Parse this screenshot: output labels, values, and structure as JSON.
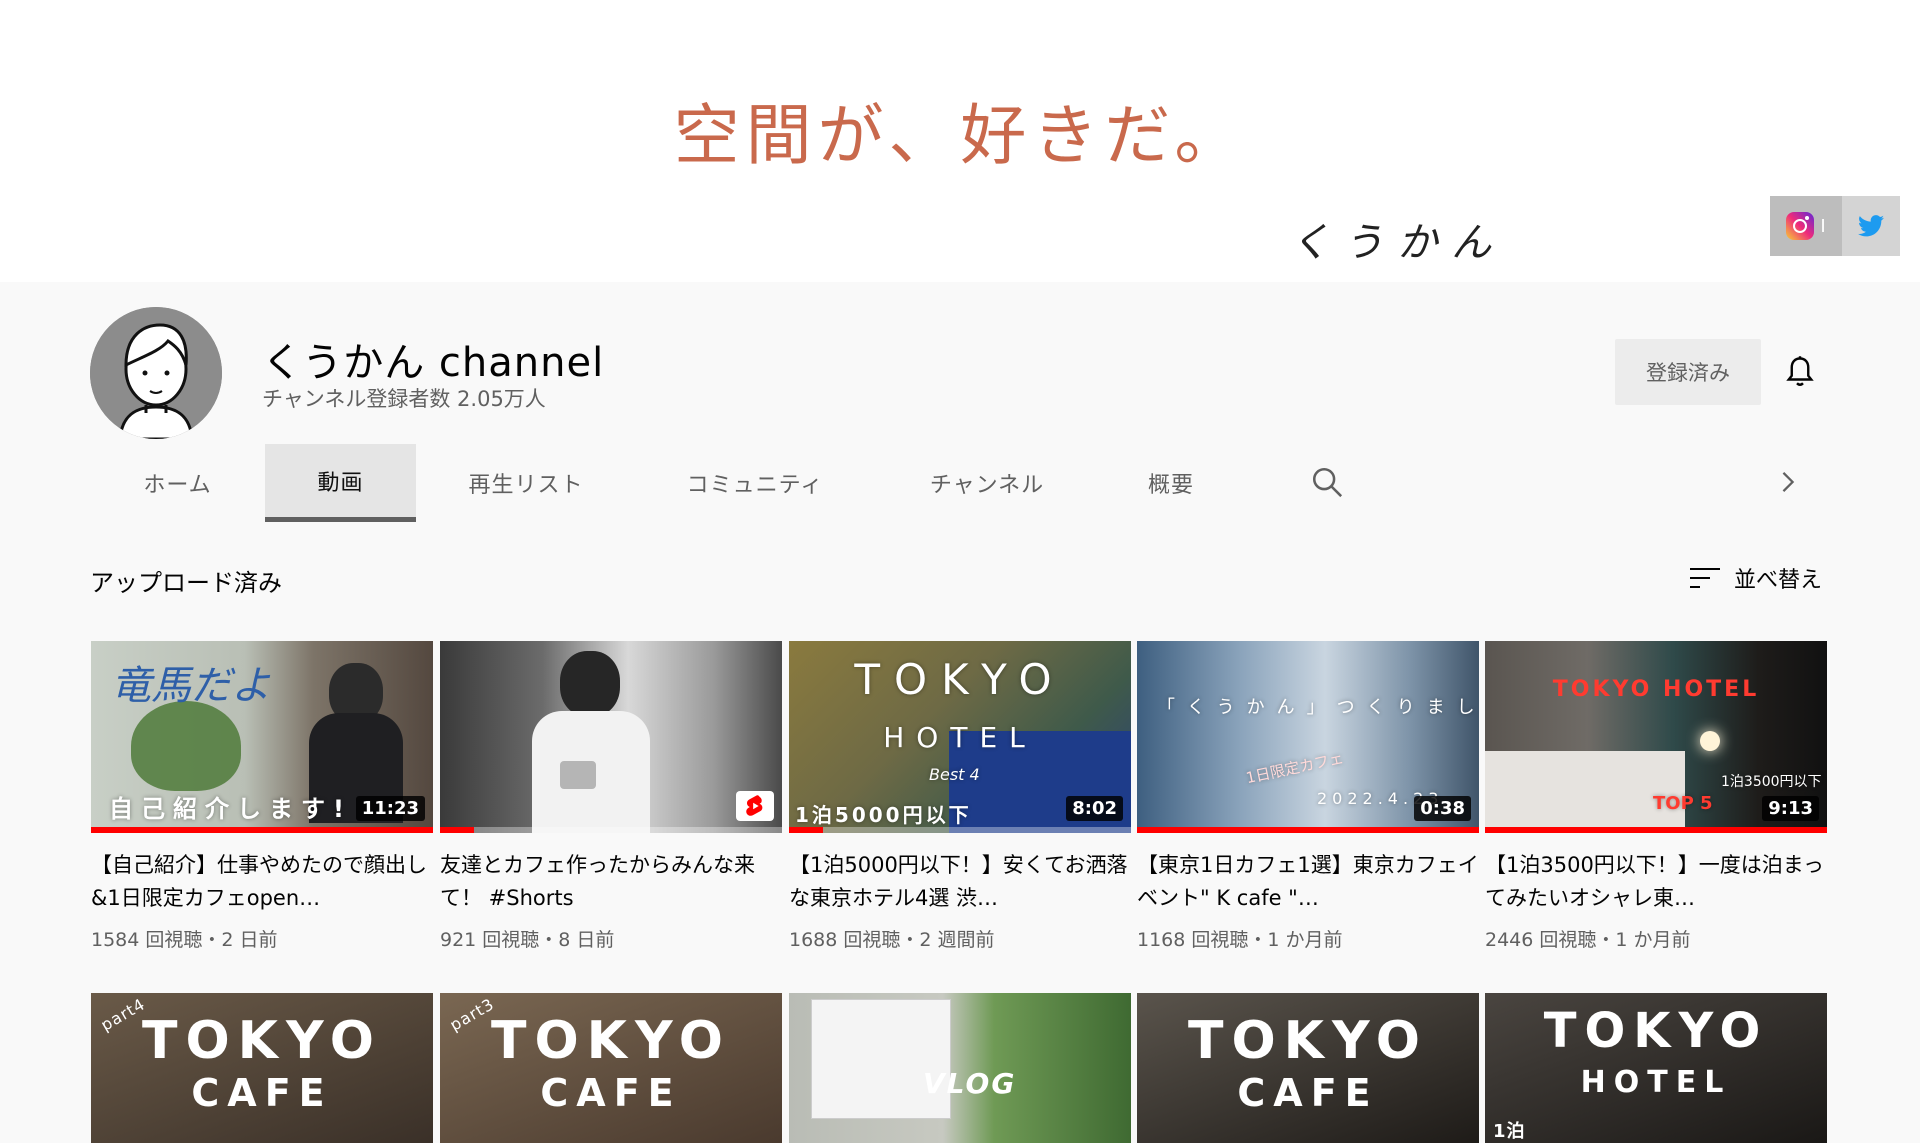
{
  "banner": {
    "tagline": "空間が、好きだ。",
    "signature": "くうかん",
    "links": {
      "instagram_icon": "instagram-icon",
      "twitter_icon": "twitter-icon",
      "instagram_text": "I"
    }
  },
  "channel": {
    "name": "くうかん channel",
    "subscribers": "チャンネル登録者数 2.05万人",
    "subscribe_label": "登録済み"
  },
  "tabs": [
    {
      "label": "ホーム"
    },
    {
      "label": "動画",
      "active": true
    },
    {
      "label": "再生リスト"
    },
    {
      "label": "コミュニティ"
    },
    {
      "label": "チャンネル"
    },
    {
      "label": "概要"
    }
  ],
  "section": {
    "title": "アップロード済み",
    "sort_label": "並べ替え"
  },
  "videos": [
    {
      "title": "【自己紹介】仕事やめたので顔出し&1日限定カフェopen…",
      "meta": "1584 回視聴・2 日前",
      "duration": "11:23",
      "thumb_text": "自己紹介します!",
      "thumb_text2": "竜馬だよ",
      "watched": 1.0,
      "bg": "#9aa39b"
    },
    {
      "title": "友達とカフェ作ったからみんな来て！ #Shorts",
      "meta": "921 回視聴・8 日前",
      "duration": "",
      "thumb_text": "",
      "watched": 0.1,
      "bg": "#6d6d6d"
    },
    {
      "title": "【1泊5000円以下！】安くてお洒落な東京ホテル4選 渋…",
      "meta": "1688 回視聴・2 週間前",
      "duration": "8:02",
      "thumb_text": "TOKYO",
      "thumb_text2": "HOTEL",
      "thumb_text3": "Best 4",
      "thumb_text4": "1泊5000円以下",
      "watched": 0.1,
      "bg": "#7a7352"
    },
    {
      "title": "【東京1日カフェ1選】東京カフェイベント\" K cafe \"…",
      "meta": "1168 回視聴・1 か月前",
      "duration": "0:38",
      "thumb_text": "「くうかん」つくりました。",
      "thumb_text2": "2022.4.23",
      "thumb_text3": "1日限定カフェ",
      "watched": 1.0,
      "bg": "#5d7890"
    },
    {
      "title": "【1泊3500円以下！】一度は泊まってみたいオシャレ東…",
      "meta": "2446 回視聴・1 か月前",
      "duration": "9:13",
      "thumb_text": "TOKYO HOTEL",
      "thumb_text2": "TOP 5",
      "thumb_text3": "1泊3500円以下",
      "watched": 1.0,
      "bg": "#3b3835"
    }
  ],
  "row2": [
    {
      "line1": "TOKYO",
      "line2": "CAFE",
      "tag": "part4",
      "bg": "#4a4036"
    },
    {
      "line1": "TOKYO",
      "line2": "CAFE",
      "tag": "part3",
      "bg": "#5a4b3e"
    },
    {
      "line1": "VLOG",
      "line2": "",
      "tag": "",
      "bg": "#8c9a8a"
    },
    {
      "line1": "TOKYO",
      "line2": "CAFE",
      "tag": "",
      "bg": "#3a3632"
    },
    {
      "line1": "TOKYO",
      "line2": "HOTEL",
      "tag": "1泊",
      "bg": "#2f2b28"
    }
  ],
  "colors": {
    "accent": "#ff0000",
    "tagline": "#c9694c"
  }
}
